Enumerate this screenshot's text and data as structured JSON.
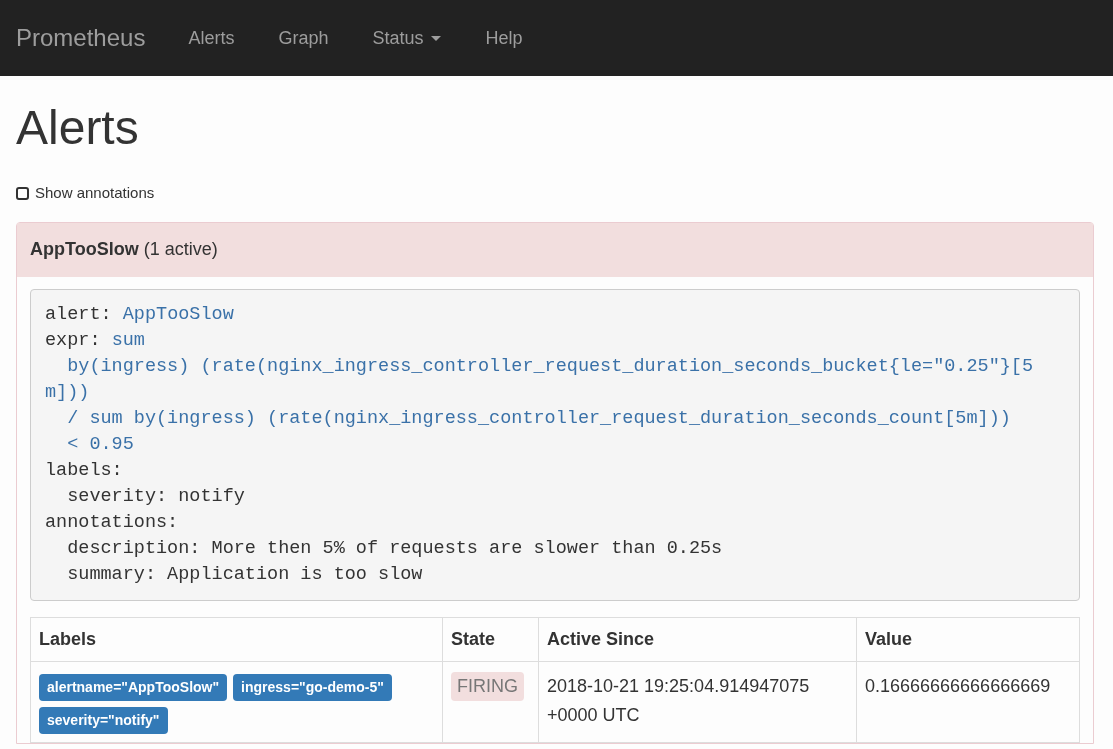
{
  "navbar": {
    "brand": "Prometheus",
    "links": [
      {
        "label": "Alerts",
        "dropdown": false
      },
      {
        "label": "Graph",
        "dropdown": false
      },
      {
        "label": "Status",
        "dropdown": true
      },
      {
        "label": "Help",
        "dropdown": false
      }
    ]
  },
  "heading": "Alerts",
  "show_annotations": {
    "label": "Show annotations",
    "checked": false
  },
  "alert_groups": [
    {
      "name": "AppTooSlow",
      "count": "(1 active)",
      "definition": [
        {
          "key": "alert:",
          "lines": [
            {
              "text": "AppTooSlow",
              "indented": false
            }
          ]
        },
        {
          "key": "expr:",
          "lines": [
            {
              "text": "sum",
              "indented": false
            },
            {
              "text": "by(ingress) (rate(nginx_ingress_controller_request_duration_seconds_bucket{le=\"0.25\"}[5",
              "indented": true
            },
            {
              "text": "m]))",
              "indented": false
            },
            {
              "text": "/ sum by(ingress) (rate(nginx_ingress_controller_request_duration_seconds_count[5m]))",
              "indented": true
            },
            {
              "text": "< 0.95",
              "indented": true
            }
          ]
        },
        {
          "key": "labels:",
          "children": [
            {
              "key": "severity:",
              "value": "notify"
            }
          ]
        },
        {
          "key": "annotations:",
          "children": [
            {
              "key": "description:",
              "value": "More then 5% of requests are slower than 0.25s"
            },
            {
              "key": "summary:",
              "value": "Application is too slow"
            }
          ]
        }
      ],
      "table": {
        "columns": [
          "Labels",
          "State",
          "Active Since",
          "Value"
        ],
        "rows": [
          {
            "labels": [
              "alertname=\"AppTooSlow\"",
              "ingress=\"go-demo-5\"",
              "severity=\"notify\""
            ],
            "state": "FIRING",
            "active_since": "2018-10-21 19:25:04.914947075 +0000 UTC",
            "value": "0.16666666666666669"
          }
        ]
      }
    }
  ]
}
